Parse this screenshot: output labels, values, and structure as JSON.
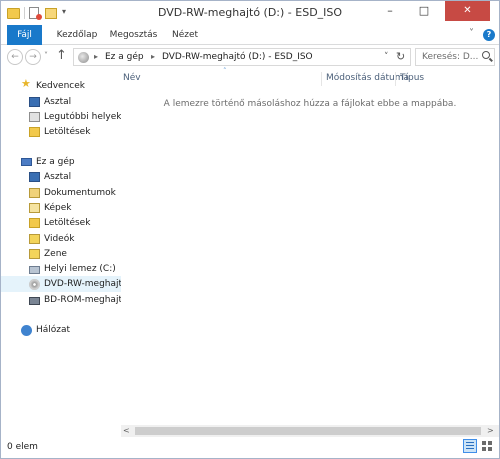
{
  "window": {
    "title": "DVD-RW-meghajtó (D:) - ESD_ISO",
    "minimize_icon": "–",
    "maximize_icon": "□",
    "close_icon": "✕"
  },
  "quick_access": {
    "dropdown_icon": "▾"
  },
  "ribbon": {
    "tabs": [
      {
        "label": "Fájl",
        "active": true
      },
      {
        "label": "Kezdőlap",
        "active": false
      },
      {
        "label": "Megosztás",
        "active": false
      },
      {
        "label": "Nézet",
        "active": false
      }
    ],
    "expand_icon": "˅",
    "help_icon": "?"
  },
  "navigation": {
    "back_icon": "←",
    "forward_icon": "→",
    "recent_icon": "˅",
    "up_icon": "↑"
  },
  "address": {
    "chevron": "▸",
    "segments": [
      "Ez a gép",
      "DVD-RW-meghajtó (D:) - ESD_ISO"
    ],
    "dropdown_icon": "˅",
    "refresh_icon": "↻"
  },
  "search": {
    "placeholder": "Keresés: D..."
  },
  "nav_pane": {
    "favorites_header": "Kedvencek",
    "favorites": [
      "Asztal",
      "Legutóbbi helyek",
      "Letöltések"
    ],
    "pc_header": "Ez a gép",
    "pc_items": [
      "Asztal",
      "Dokumentumok",
      "Képek",
      "Letöltések",
      "Videók",
      "Zene",
      "Helyi lemez (C:)",
      "DVD-RW-meghajtó",
      "BD-ROM-meghajtó"
    ],
    "selected": "DVD-RW-meghajtó",
    "network": "Hálózat"
  },
  "content": {
    "sort_arrow": "˄",
    "columns": [
      "Név",
      "Módosítás dátuma",
      "Típus"
    ],
    "empty_message": "A lemezre történő másoláshoz húzza a fájlokat ebbe a mappába."
  },
  "scrollbar": {
    "left_icon": "<",
    "right_icon": ">"
  },
  "status": {
    "item_count": "0 elem"
  },
  "colors": {
    "accent": "#1979ca",
    "close": "#c74a44",
    "selection": "#e5f3fb"
  }
}
